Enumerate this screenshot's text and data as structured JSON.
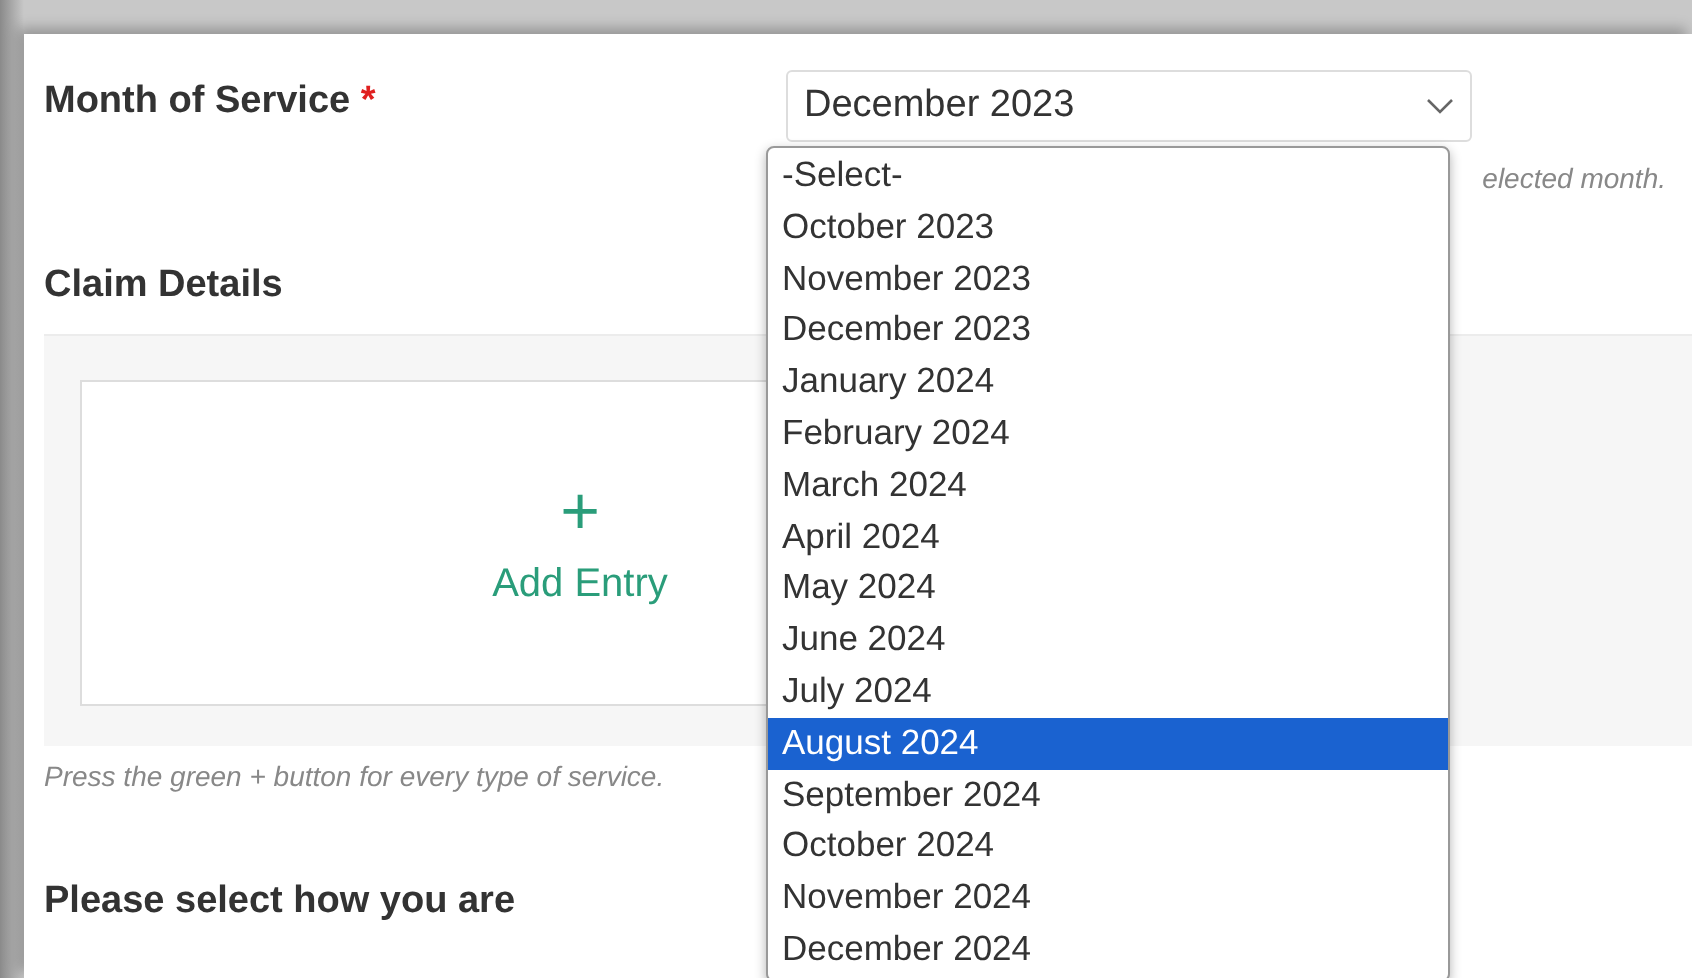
{
  "month_of_service": {
    "label": "Month of Service",
    "required_mark": "*",
    "select_value": "December 2023",
    "hint_visible_end": "elected month.",
    "options": [
      {
        "label": "-Select-",
        "selected": false
      },
      {
        "label": "October 2023",
        "selected": false
      },
      {
        "label": "November 2023",
        "selected": false
      },
      {
        "label": "December 2023",
        "selected": false
      },
      {
        "label": "January 2024",
        "selected": false
      },
      {
        "label": "February 2024",
        "selected": false
      },
      {
        "label": "March 2024",
        "selected": false
      },
      {
        "label": "April 2024",
        "selected": false
      },
      {
        "label": "May 2024",
        "selected": false
      },
      {
        "label": "June 2024",
        "selected": false
      },
      {
        "label": "July 2024",
        "selected": false
      },
      {
        "label": "August 2024",
        "selected": true
      },
      {
        "label": "September 2024",
        "selected": false
      },
      {
        "label": "October 2024",
        "selected": false
      },
      {
        "label": "November 2024",
        "selected": false
      },
      {
        "label": "December 2024",
        "selected": false
      }
    ]
  },
  "claim_details": {
    "heading": "Claim Details",
    "add_icon": "+",
    "add_label": "Add Entry",
    "hint": "Press the green + button for every type of service."
  },
  "reimbursement": {
    "label": "Please select how you are"
  }
}
